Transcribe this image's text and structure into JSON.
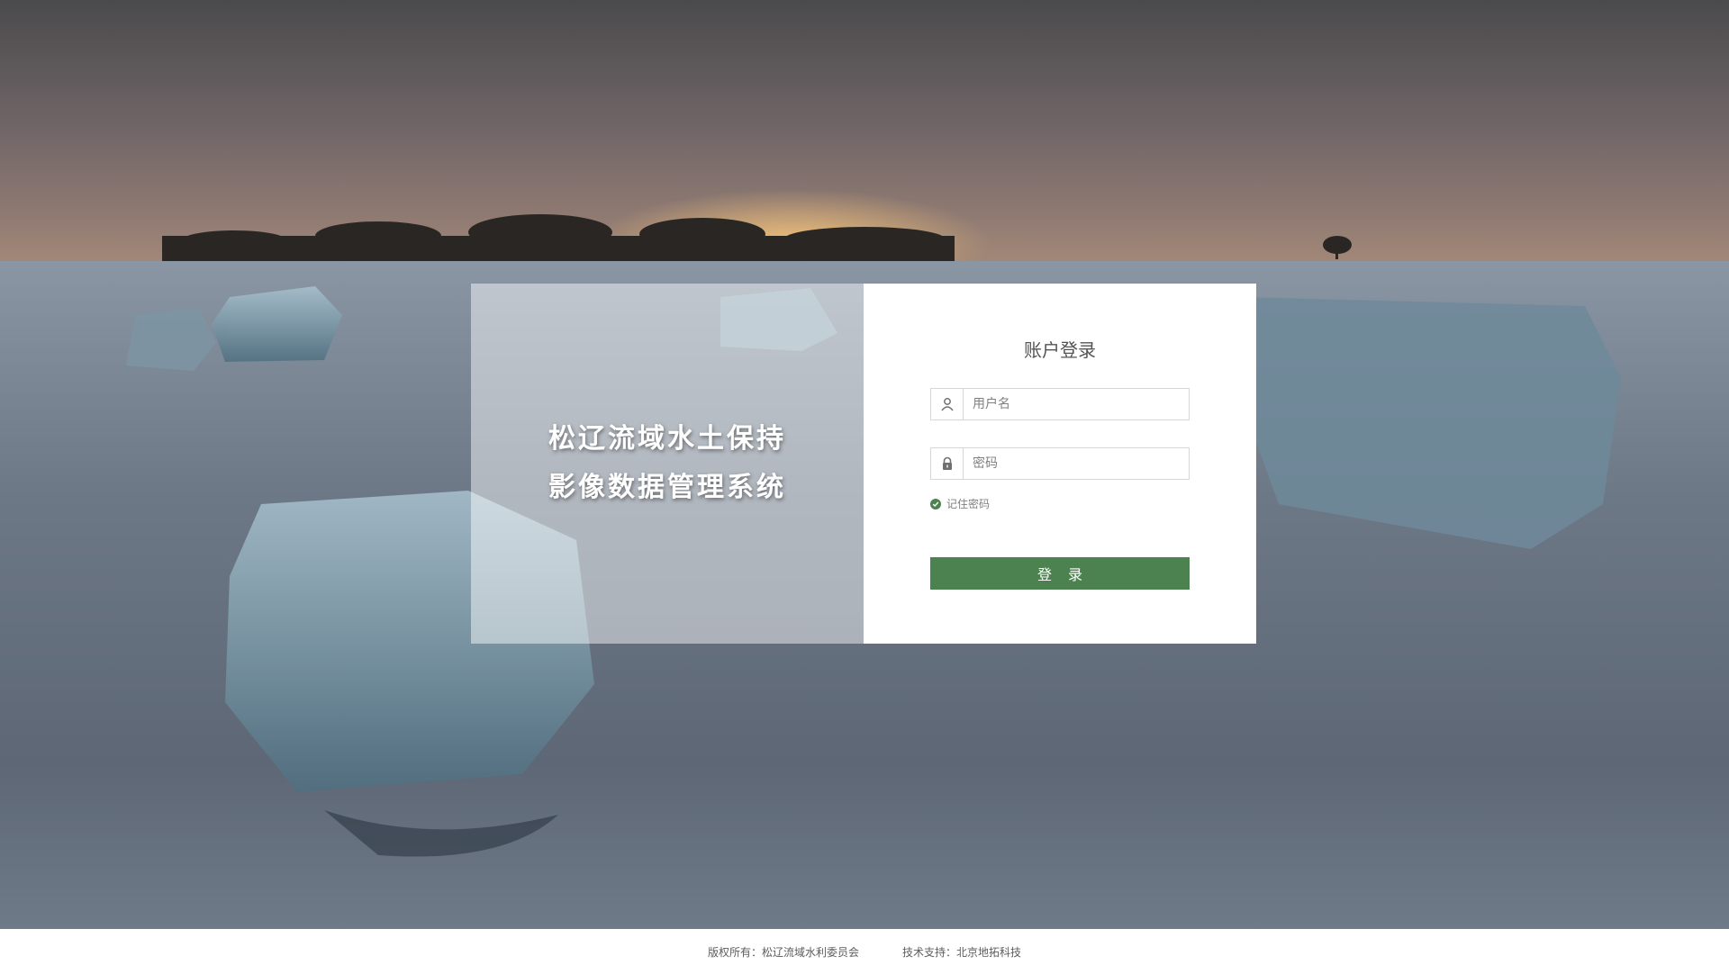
{
  "intro": {
    "line1": "松辽流域水土保持",
    "line2": "影像数据管理系统"
  },
  "login": {
    "title": "账户登录",
    "username_placeholder": "用户名",
    "password_placeholder": "密码",
    "remember_label": "记住密码",
    "submit_label": "登录"
  },
  "footer": {
    "copyright": "版权所有：松辽流域水利委员会",
    "tech_support": "技术支持：北京地拓科技"
  },
  "colors": {
    "accent": "#4c8250",
    "title_text": "#535353",
    "field_text": "#808080",
    "footer_text": "#5d5d5d",
    "panel_bg": "#ffffff"
  },
  "icons": {
    "username": "user-icon",
    "password": "lock-icon",
    "remember": "check-circle-icon"
  }
}
